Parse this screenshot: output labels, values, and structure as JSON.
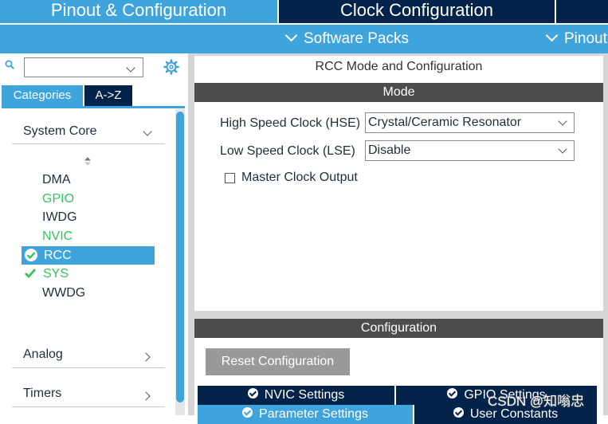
{
  "top_tabs": {
    "pinout": "Pinout & Configuration",
    "clock": "Clock Configuration"
  },
  "sub_menu": {
    "software_packs": "Software Packs",
    "pinout": "Pinout"
  },
  "left_panel": {
    "search_value": "",
    "tabs": {
      "categories": "Categories",
      "az": "A->Z"
    },
    "categories": {
      "system_core": "System Core",
      "analog": "Analog",
      "timers": "Timers"
    },
    "peripherals": [
      {
        "label": "DMA",
        "status": "none"
      },
      {
        "label": "GPIO",
        "status": "configured"
      },
      {
        "label": "IWDG",
        "status": "none"
      },
      {
        "label": "NVIC",
        "status": "configured"
      },
      {
        "label": "RCC",
        "status": "selected"
      },
      {
        "label": "SYS",
        "status": "ok"
      },
      {
        "label": "WWDG",
        "status": "none"
      }
    ]
  },
  "main": {
    "title": "RCC Mode and Configuration",
    "mode_header": "Mode",
    "hse_label": "High Speed Clock (HSE)",
    "hse_value": "Crystal/Ceramic Resonator",
    "lse_label": "Low Speed Clock (LSE)",
    "lse_value": "Disable",
    "mco_label": "Master Clock Output",
    "mco_checked": false,
    "config_header": "Configuration",
    "reset_label": "Reset Configuration",
    "config_tabs": {
      "nvic": "NVIC Settings",
      "gpio": "GPIO Settings",
      "param": "Parameter Settings",
      "user_const": "User Constants"
    }
  },
  "watermark": "CSDN @知嗡忠",
  "colors": {
    "accent_blue": "#3fa4dc",
    "navy": "#03234b",
    "green": "#34c45a",
    "header_gray": "#4d4d4d"
  }
}
